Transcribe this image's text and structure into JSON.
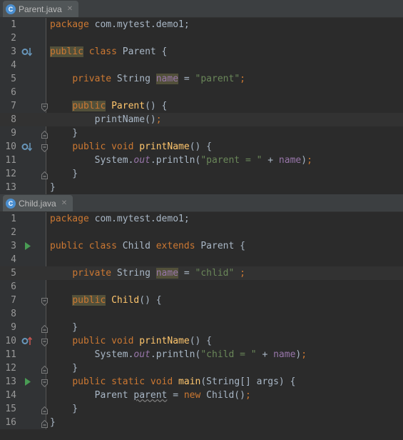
{
  "panes": [
    {
      "tab": {
        "label": "Parent.java",
        "icon_letter": "C"
      },
      "lines": [
        {
          "n": "1",
          "tokens": [
            [
              "kw",
              "package"
            ],
            [
              "p",
              " com.mytest.demo1;"
            ]
          ]
        },
        {
          "n": "2",
          "tokens": []
        },
        {
          "n": "3",
          "marker": "override",
          "tokens": [
            [
              "kw hl",
              "public"
            ],
            [
              "p",
              " "
            ],
            [
              "kw",
              "class"
            ],
            [
              "p",
              " Parent {"
            ]
          ]
        },
        {
          "n": "4",
          "tokens": []
        },
        {
          "n": "5",
          "tokens": [
            [
              "p",
              "    "
            ],
            [
              "kw",
              "private"
            ],
            [
              "p",
              " String "
            ],
            [
              "fld hl",
              "name"
            ],
            [
              "p",
              " = "
            ],
            [
              "str",
              "\"parent\""
            ],
            [
              "kw",
              ";"
            ]
          ]
        },
        {
          "n": "6",
          "tokens": []
        },
        {
          "n": "7",
          "fold": "open",
          "tokens": [
            [
              "p",
              "    "
            ],
            [
              "kw hl",
              "public"
            ],
            [
              "p",
              " "
            ],
            [
              "fn",
              "Parent"
            ],
            [
              "p",
              "() {"
            ]
          ]
        },
        {
          "n": "8",
          "current": true,
          "tokens": [
            [
              "p",
              "        printName()"
            ],
            [
              "kw",
              ";"
            ]
          ]
        },
        {
          "n": "9",
          "fold": "close",
          "tokens": [
            [
              "p",
              "    }"
            ]
          ]
        },
        {
          "n": "10",
          "marker": "override",
          "fold": "open",
          "tokens": [
            [
              "p",
              "    "
            ],
            [
              "kw",
              "public"
            ],
            [
              "p",
              " "
            ],
            [
              "kw",
              "void"
            ],
            [
              "p",
              " "
            ],
            [
              "fn",
              "printName"
            ],
            [
              "p",
              "() {"
            ]
          ]
        },
        {
          "n": "11",
          "tokens": [
            [
              "p",
              "        System."
            ],
            [
              "stf",
              "out"
            ],
            [
              "p",
              ".println("
            ],
            [
              "str",
              "\"parent = \""
            ],
            [
              "p",
              " + "
            ],
            [
              "fld",
              "name"
            ],
            [
              "p",
              ")"
            ],
            [
              "kw",
              ";"
            ]
          ]
        },
        {
          "n": "12",
          "fold": "close",
          "tokens": [
            [
              "p",
              "    }"
            ]
          ]
        },
        {
          "n": "13",
          "tokens": [
            [
              "p",
              "}"
            ]
          ]
        }
      ]
    },
    {
      "tab": {
        "label": "Child.java",
        "icon_letter": "C"
      },
      "lines": [
        {
          "n": "1",
          "tokens": [
            [
              "kw",
              "package"
            ],
            [
              "p",
              " com.mytest.demo1;"
            ]
          ]
        },
        {
          "n": "2",
          "tokens": []
        },
        {
          "n": "3",
          "marker": "run",
          "tokens": [
            [
              "kw",
              "public"
            ],
            [
              "p",
              " "
            ],
            [
              "kw",
              "class"
            ],
            [
              "p",
              " Child "
            ],
            [
              "kw",
              "extends"
            ],
            [
              "p",
              " Parent {"
            ]
          ]
        },
        {
          "n": "4",
          "tokens": []
        },
        {
          "n": "5",
          "current": true,
          "tokens": [
            [
              "p",
              "    "
            ],
            [
              "kw",
              "private"
            ],
            [
              "p",
              " String "
            ],
            [
              "fld hl",
              "name"
            ],
            [
              "p",
              " = "
            ],
            [
              "str",
              "\"chlid\""
            ],
            [
              "p",
              " "
            ],
            [
              "kw",
              ";"
            ]
          ]
        },
        {
          "n": "6",
          "tokens": []
        },
        {
          "n": "7",
          "fold": "open",
          "tokens": [
            [
              "p",
              "    "
            ],
            [
              "kw hl",
              "public"
            ],
            [
              "p",
              " "
            ],
            [
              "fn",
              "Child"
            ],
            [
              "p",
              "() {"
            ]
          ]
        },
        {
          "n": "8",
          "tokens": []
        },
        {
          "n": "9",
          "fold": "close",
          "tokens": [
            [
              "p",
              "    }"
            ]
          ]
        },
        {
          "n": "10",
          "marker": "overrides",
          "fold": "open",
          "tokens": [
            [
              "p",
              "    "
            ],
            [
              "kw",
              "public"
            ],
            [
              "p",
              " "
            ],
            [
              "kw",
              "void"
            ],
            [
              "p",
              " "
            ],
            [
              "fn",
              "printName"
            ],
            [
              "p",
              "() {"
            ]
          ]
        },
        {
          "n": "11",
          "tokens": [
            [
              "p",
              "        System."
            ],
            [
              "stf",
              "out"
            ],
            [
              "p",
              ".println("
            ],
            [
              "str",
              "\"child = \""
            ],
            [
              "p",
              " + "
            ],
            [
              "fld",
              "name"
            ],
            [
              "p",
              ")"
            ],
            [
              "kw",
              ";"
            ]
          ]
        },
        {
          "n": "12",
          "fold": "close",
          "tokens": [
            [
              "p",
              "    }"
            ]
          ]
        },
        {
          "n": "13",
          "marker": "run",
          "fold": "open",
          "tokens": [
            [
              "p",
              "    "
            ],
            [
              "kw",
              "public"
            ],
            [
              "p",
              " "
            ],
            [
              "kw",
              "static"
            ],
            [
              "p",
              " "
            ],
            [
              "kw",
              "void"
            ],
            [
              "p",
              " "
            ],
            [
              "fn",
              "main"
            ],
            [
              "p",
              "(String[] args) {"
            ]
          ]
        },
        {
          "n": "14",
          "tokens": [
            [
              "p",
              "        Parent "
            ],
            [
              "ul",
              "parent"
            ],
            [
              "p",
              " = "
            ],
            [
              "kw",
              "new"
            ],
            [
              "p",
              " Child()"
            ],
            [
              "kw",
              ";"
            ]
          ]
        },
        {
          "n": "15",
          "fold": "close",
          "tokens": [
            [
              "p",
              "    }"
            ]
          ]
        },
        {
          "n": "16",
          "fold": "close",
          "tokens": [
            [
              "p",
              "}"
            ]
          ]
        }
      ]
    }
  ],
  "colors": {
    "keyword": "#cc7832",
    "string": "#6a8759",
    "field": "#9876aa",
    "method": "#ffc66d",
    "text": "#a9b7c6",
    "background": "#2b2b2b",
    "gutter": "#313335"
  },
  "icons": {
    "override": "override-gutter-icon",
    "overrides": "overrides-gutter-icon",
    "run": "run-gutter-icon",
    "fold": "fold-icon",
    "file": "java-class-icon",
    "close": "close-icon"
  }
}
